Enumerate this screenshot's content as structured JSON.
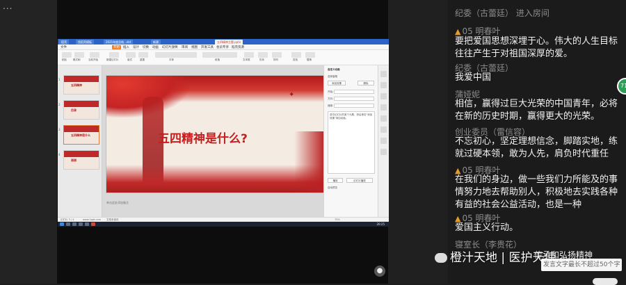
{
  "top_left": {
    "more_label": "..."
  },
  "screen": {
    "tabs": [
      "稻壳",
      "找稻壳模板",
      "2021年度总结...dst",
      "新建",
      "五四精神主题.pptx"
    ],
    "menus": [
      "文件",
      "开始",
      "插入",
      "设计",
      "切换",
      "动画",
      "幻灯片放映",
      "审阅",
      "视图",
      "开发工具",
      "会员专享",
      "稻壳资源"
    ],
    "active_menu": "开始",
    "ribbon_labels": [
      "粘贴",
      "格式刷",
      "当前开始",
      "新建幻灯片",
      "版式",
      "重置",
      "字体",
      "段落",
      "文本框",
      "形状",
      "排列",
      "查找",
      "替换"
    ],
    "thumbnails": [
      {
        "num": "1",
        "text": "五四精神"
      },
      {
        "num": "2",
        "text": "目录"
      },
      {
        "num": "3",
        "text": "五四精神是什么"
      },
      {
        "num": "4",
        "text": "谢谢"
      }
    ],
    "slide_title": "五四精神是什么?",
    "notes_placeholder": "单击此处添加备注",
    "right_panel": {
      "title": "自定义动画",
      "lines": [
        "选择窗格",
        "添加效果",
        "删除",
        "开始:",
        "方向:",
        "速度:"
      ],
      "hint": "选中幻灯片的某个元素，然后单击\"添加效果\"添加动画。",
      "play_button": "播放",
      "preview_button": "幻灯片播放",
      "autopreview": "自动预览"
    },
    "status": {
      "slide_counter": "幻灯片 3 / 4",
      "site": "www.1ppt.com",
      "font_note": "文档未保存",
      "zoom": "75%"
    },
    "taskbar_time": "20:25"
  },
  "chat": {
    "join_notice": "纪委（古蕾廷） 进入房间",
    "messages": [
      {
        "vip": true,
        "name": "05  明春叶",
        "text": "要把爱国思想深埋于心。伟大的人生目标往往产生于对祖国深厚的爱。"
      },
      {
        "vip": false,
        "name": "纪委（古蕾廷）",
        "text": "我爱中国"
      },
      {
        "vip": false,
        "name": "蒲娅妮",
        "text": "相信，赢得过巨大光荣的中国青年，必将在新的历史时期，赢得更大的光荣。"
      },
      {
        "vip": false,
        "name": "创业委员（雷信容）",
        "text": "不忘初心，坚定理想信念，脚踏实地，练就过硬本领，敢为人先，肩负时代重任"
      },
      {
        "vip": true,
        "name": "05  明春叶",
        "text": "在我们的身边，做一些我们力所能及的事情努力地去帮助别人，积极地去实践各种有益的社会公益活动，也是一种"
      },
      {
        "vip": true,
        "name": "05  明春叶",
        "text": "爱国主义行动。"
      },
      {
        "vip": false,
        "name": "寝室长（李贵花）",
        "text": "传承和弘扬精神"
      }
    ],
    "green_count": "71",
    "input_placeholder": "发言文字最长不超过50个字"
  },
  "watermark": "橙汁天地 | 医护天使",
  "colors": {
    "wps_blue": "#2b63c6",
    "ribbon_orange": "#ef7d2b",
    "slide_red": "#c41f1f",
    "vip_orange": "#e79a2c",
    "chat_bg": "#1b1b1b"
  }
}
